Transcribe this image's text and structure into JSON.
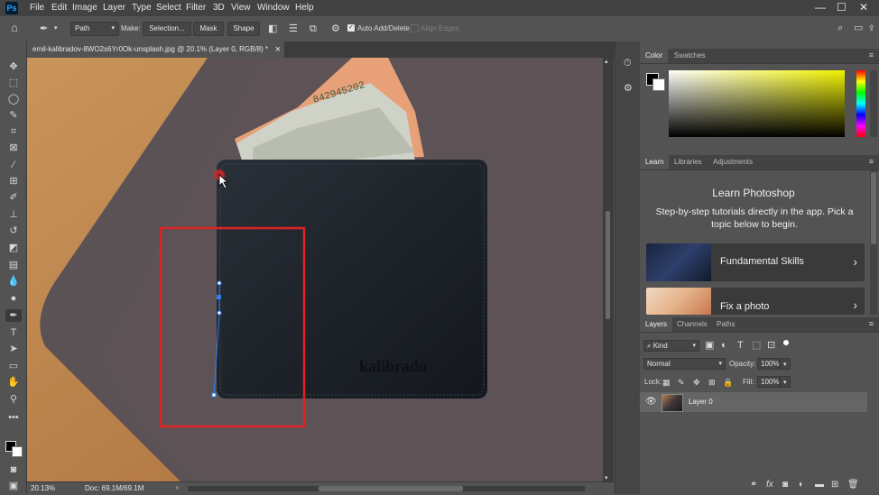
{
  "app": {
    "logo": "Ps"
  },
  "menubar": {
    "items": [
      "File",
      "Edit",
      "Image",
      "Layer",
      "Type",
      "Select",
      "Filter",
      "3D",
      "View",
      "Window",
      "Help"
    ]
  },
  "window_controls": {
    "minimize": "—",
    "maximize": "☐",
    "close": "✕"
  },
  "options": {
    "mode": "Path",
    "make_label": "Make:",
    "selection_btn": "Selection...",
    "mask_btn": "Mask",
    "shape_btn": "Shape",
    "auto_add_delete": "Auto Add/Delete",
    "auto_add_checked": true,
    "align_edges": "Align Edges"
  },
  "document": {
    "tab_title": "emil-kalibradov-8WO2s6Yr0Ok-unsplash.jpg @ 20.1% (Layer 0, RGB/8) *",
    "close": "×",
    "wallet_brand": "kalibrado",
    "bill_serial": "842945202"
  },
  "status": {
    "zoom": "20.13%",
    "doc_size": "Doc: 69.1M/69.1M",
    "arrow": "›"
  },
  "color_panel": {
    "tabs": [
      "Color",
      "Swatches"
    ],
    "active": "Color",
    "hue": "#f2f200"
  },
  "learn_panel": {
    "tabs": [
      "Learn",
      "Libraries",
      "Adjustments"
    ],
    "active": "Learn",
    "title": "Learn Photoshop",
    "description": "Step-by-step tutorials directly in the app. Pick a topic below to begin.",
    "cards": [
      {
        "label": "Fundamental Skills",
        "chevron": "›"
      },
      {
        "label": "Fix a photo",
        "chevron": "›"
      }
    ]
  },
  "layers_panel": {
    "tabs": [
      "Layers",
      "Channels",
      "Paths"
    ],
    "active": "Layers",
    "filter_kind": "Kind",
    "blend_mode": "Normal",
    "opacity_label": "Opacity:",
    "opacity_value": "100%",
    "lock_label": "Lock:",
    "fill_label": "Fill:",
    "fill_value": "100%",
    "layers": [
      {
        "name": "Layer 0",
        "visible": true
      }
    ],
    "footer_fx": "fx"
  },
  "colors": {
    "accent": "#2f80ed",
    "red_box": "#e02424",
    "panel_bg": "#535353",
    "dark": "#3c3c3c"
  }
}
